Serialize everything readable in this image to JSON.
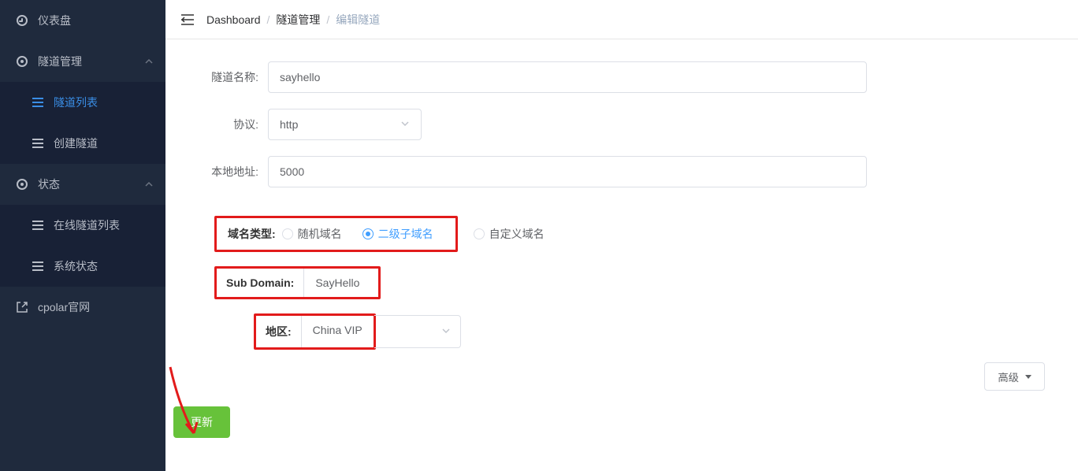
{
  "sidebar": {
    "items": [
      {
        "label": "仪表盘"
      },
      {
        "label": "隧道管理"
      },
      {
        "label": "隧道列表"
      },
      {
        "label": "创建隧道"
      },
      {
        "label": "状态"
      },
      {
        "label": "在线隧道列表"
      },
      {
        "label": "系统状态"
      },
      {
        "label": "cpolar官网"
      }
    ]
  },
  "breadcrumb": {
    "dashboard": "Dashboard",
    "tunnel_mgmt": "隧道管理",
    "edit_tunnel": "编辑隧道"
  },
  "form": {
    "tunnel_name_label": "隧道名称:",
    "tunnel_name_value": "sayhello",
    "protocol_label": "协议:",
    "protocol_value": "http",
    "local_addr_label": "本地地址:",
    "local_addr_value": "5000",
    "domain_type_label": "域名类型:",
    "radio_random": "随机域名",
    "radio_subdomain": "二级子域名",
    "radio_custom": "自定义域名",
    "subdomain_label": "Sub Domain:",
    "subdomain_value": "SayHello",
    "region_label": "地区:",
    "region_value": "China VIP"
  },
  "buttons": {
    "advanced": "高级",
    "update": "更新"
  }
}
